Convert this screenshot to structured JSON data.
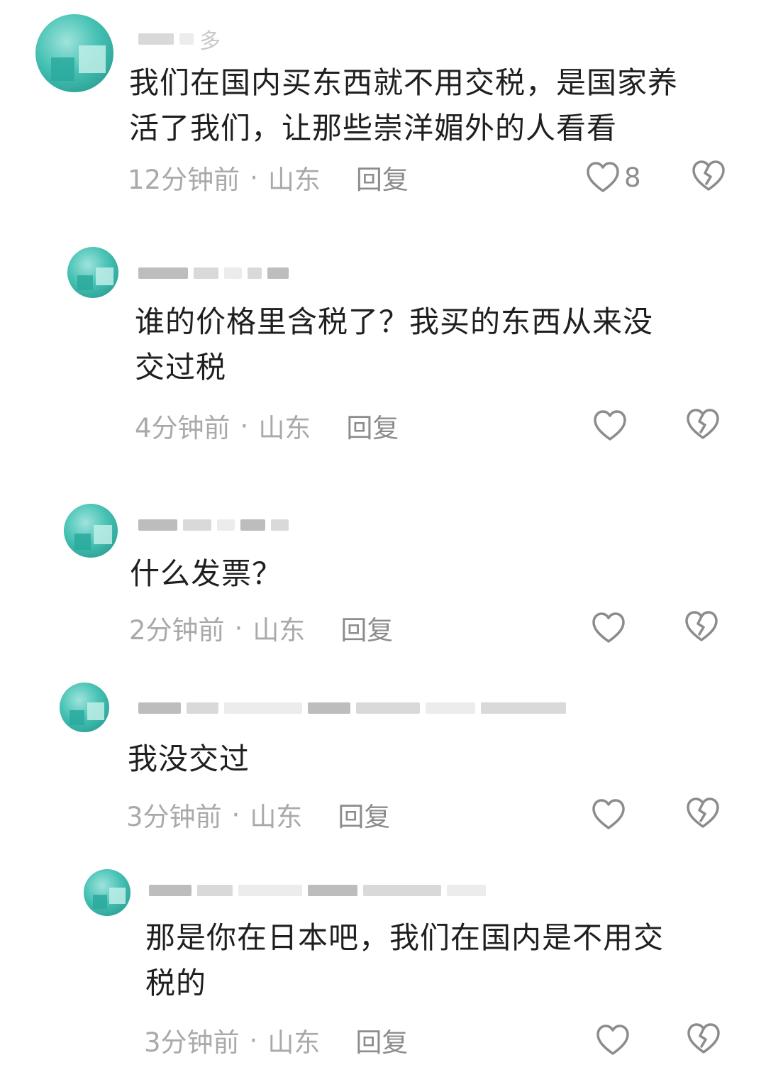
{
  "comments": [
    {
      "text": "我们在国内买东西就不用交税，是国家养\n活了我们，让那些崇洋媚外的人看看",
      "time": "12分钟前",
      "location": "山东",
      "reply_label": "回复",
      "likes": "8",
      "username_visible": "多"
    },
    {
      "text": "谁的价格里含税了？我买的东西从来没\n交过税",
      "time": "4分钟前",
      "location": "山东",
      "reply_label": "回复",
      "likes": ""
    },
    {
      "text": "什么发票？",
      "time": "2分钟前",
      "location": "山东",
      "reply_label": "回复",
      "likes": ""
    },
    {
      "text": "我没交过",
      "time": "3分钟前",
      "location": "山东",
      "reply_label": "回复",
      "likes": ""
    },
    {
      "text": "那是你在日本吧，我们在国内是不用交\n税的",
      "time": "3分钟前",
      "location": "山东",
      "reply_label": "回复",
      "likes": ""
    }
  ],
  "icons": {
    "like": "heart-outline-icon",
    "dislike": "broken-heart-icon"
  },
  "colors": {
    "text": "#1f1f1f",
    "meta": "#a9a9a9",
    "icon": "#8c8c8c",
    "avatar": "#46c2b4"
  }
}
